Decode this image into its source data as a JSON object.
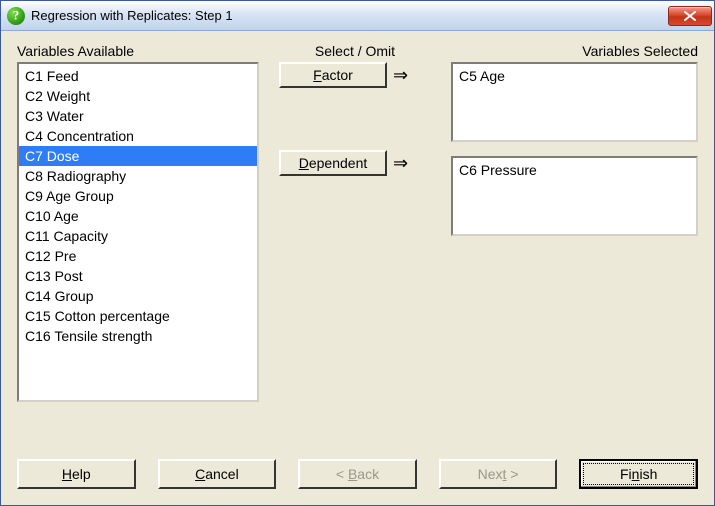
{
  "window": {
    "title": "Regression with Replicates: Step 1"
  },
  "labels": {
    "available": "Variables Available",
    "selectOmit": "Select / Omit",
    "selected": "Variables Selected"
  },
  "buttons": {
    "factor_pre": "F",
    "factor_post": "actor",
    "dependent_pre": "D",
    "dependent_post": "ependent",
    "help_pre": "H",
    "help_post": "elp",
    "cancel_pre": "C",
    "cancel_post": "ancel",
    "back_pre": "< ",
    "back_u": "B",
    "back_post": "ack",
    "next_pre": "Nex",
    "next_u": "t",
    "next_post": " >",
    "finish_pre": "Fi",
    "finish_u": "n",
    "finish_post": "ish"
  },
  "available": {
    "items": [
      "C1 Feed",
      "C2 Weight",
      "C3 Water",
      "C4 Concentration",
      "C7 Dose",
      "C8 Radiography",
      "C9 Age Group",
      "C10 Age",
      "C11 Capacity",
      "C12 Pre",
      "C13 Post",
      "C14 Group",
      "C15 Cotton percentage",
      "C16 Tensile strength"
    ],
    "selectedIndex": 4
  },
  "factorBox": "C5 Age",
  "dependentBox": "C6 Pressure",
  "arrow": "⇒"
}
